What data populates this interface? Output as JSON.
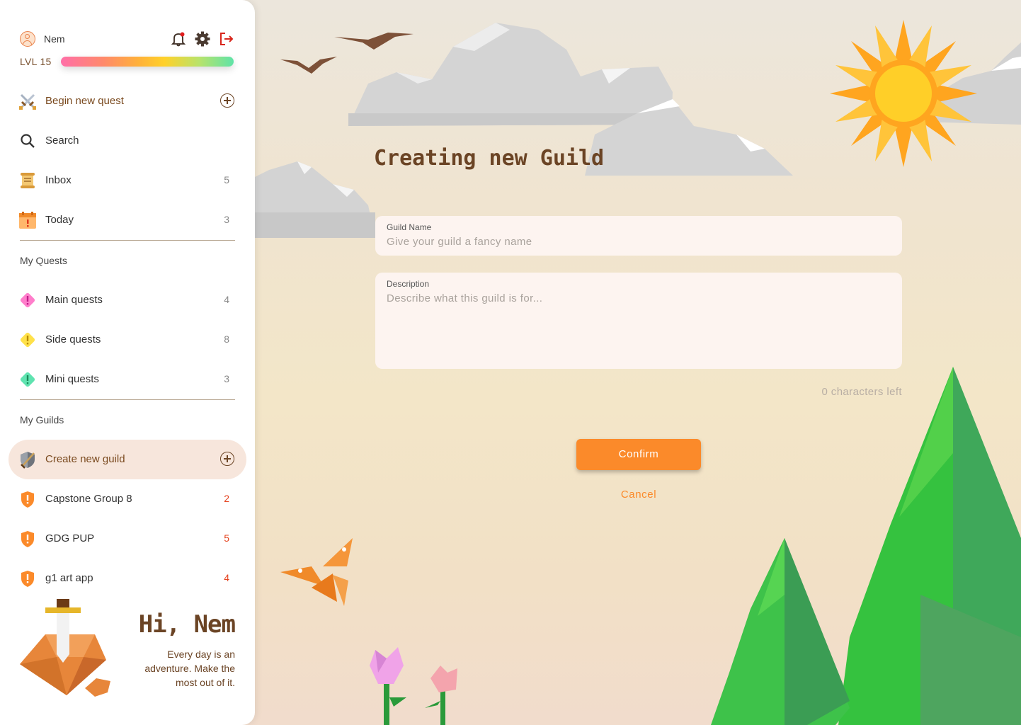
{
  "user": {
    "name": "Nem",
    "level_label": "LVL 15",
    "xp_fraction": 1.0
  },
  "topbar": {
    "icons": [
      "notification-bell-icon",
      "settings-gear-icon",
      "logout-icon"
    ]
  },
  "nav": {
    "begin_quest": "Begin new quest",
    "search": "Search",
    "inbox": {
      "label": "Inbox",
      "count": "5"
    },
    "today": {
      "label": "Today",
      "count": "3"
    }
  },
  "quests": {
    "heading": "My Quests",
    "items": [
      {
        "label": "Main quests",
        "count": "4",
        "color": "#ff7ecb"
      },
      {
        "label": "Side quests",
        "count": "8",
        "color": "#ffe14a"
      },
      {
        "label": "Mini quests",
        "count": "3",
        "color": "#5fe3b0"
      }
    ]
  },
  "guilds": {
    "heading": "My Guilds",
    "create": "Create new guild",
    "items": [
      {
        "label": "Capstone Group 8",
        "count": "2"
      },
      {
        "label": "GDG PUP",
        "count": "5"
      },
      {
        "label": "g1 art app",
        "count": "4"
      }
    ]
  },
  "greeting": {
    "hi": "Hi, Nem",
    "tagline": "Every day is an adventure. Make the most out of it."
  },
  "form": {
    "title": "Creating new Guild",
    "name_label": "Guild Name",
    "name_placeholder": "Give your guild a fancy name",
    "desc_label": "Description",
    "desc_placeholder": "Describe what this guild is for...",
    "char_count": "0 characters left",
    "confirm": "Confirm",
    "cancel": "Cancel"
  },
  "colors": {
    "accent": "#fb8a2a",
    "brown": "#6b4425",
    "active_bg": "#f7e6dc",
    "guild_badge": "#fb8a2a",
    "count_red": "#e5431f"
  }
}
